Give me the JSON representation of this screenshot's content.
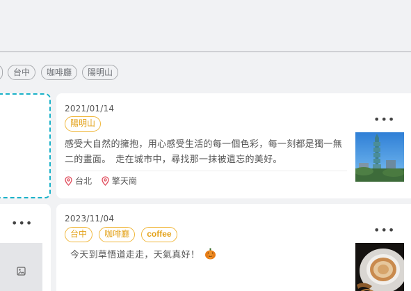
{
  "filter_tags": [
    "台中",
    "咖啡廳",
    "陽明山"
  ],
  "posts": [
    {
      "date": "2021/01/14",
      "tags": [
        "陽明山"
      ],
      "text": "感受大自然的擁抱，用心感受生活的每一個色彩，每一刻都是獨一無二的畫面。　走在城市中，尋找那一抹被遺忘的美好。",
      "locations": [
        "台北",
        "擎天崗"
      ],
      "more": "•••"
    },
    {
      "date": "2023/11/04",
      "tags": [
        "台中",
        "咖啡廳",
        "coffee"
      ],
      "text": "今天到草悟道走走，天氣真好！",
      "more": "•••"
    }
  ],
  "left_card": {
    "more": "•••"
  },
  "colors": {
    "accent": "#f0b73b",
    "draft_border": "#19b1c8",
    "location_pin": "#e04a5a"
  }
}
